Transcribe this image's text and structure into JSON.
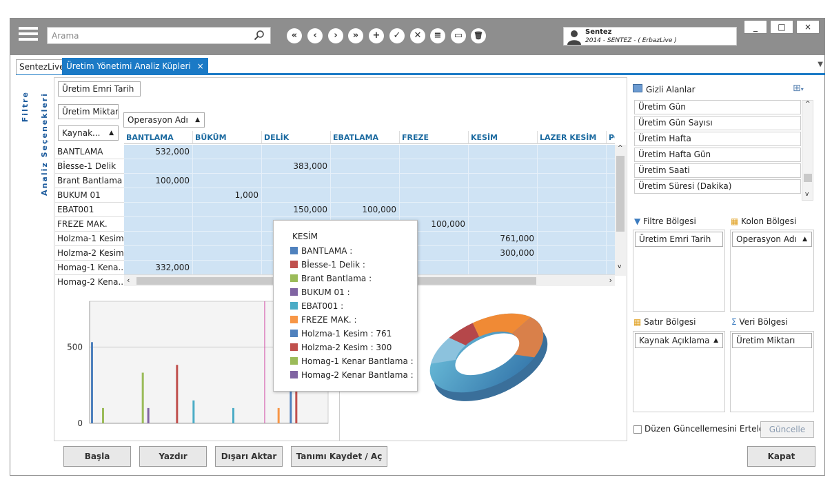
{
  "toolbar": {
    "search_placeholder": "Arama",
    "nav_labels": [
      "«",
      "‹",
      "›",
      "»",
      "+",
      "✓",
      "✕",
      "≡",
      "▭",
      "🗑"
    ]
  },
  "user": {
    "name": "Sentez",
    "subtitle": "2014 - SENTEZ - ( ErbazLive )"
  },
  "window_buttons": [
    "_",
    "□",
    "×"
  ],
  "tabs": [
    {
      "label": "SentezLive"
    },
    {
      "label": "Üretim Yönetimi Analiz Küpleri",
      "close": "×"
    }
  ],
  "side_labels": {
    "filter": "Filtre",
    "analysis": "Analiz Seçenekleri"
  },
  "pivot": {
    "filter_field": "Üretim Emri Tarih",
    "data_field": "Üretim Miktarı",
    "column_field": "Operasyon Adı",
    "row_field": "Kaynak...",
    "columns": [
      "BANTLAMA",
      "BÜKÜM",
      "DELİK",
      "EBATLAMA",
      "FREZE",
      "KESİM",
      "LAZER KESİM",
      "POS"
    ],
    "rows": [
      "BANTLAMA",
      "Bİesse-1 Delik",
      "Brant Bantlama",
      "BUKUM 01",
      "EBAT001",
      "FREZE MAK.",
      "Holzma-1 Kesim",
      "Holzma-2 Kesim",
      "Homag-1 Kena...",
      "Homag-2 Kena..."
    ],
    "values": [
      [
        "532,000",
        "",
        "",
        "",
        "",
        "",
        "",
        ""
      ],
      [
        "",
        "",
        "383,000",
        "",
        "",
        "",
        "",
        ""
      ],
      [
        "100,000",
        "",
        "",
        "",
        "",
        "",
        "",
        ""
      ],
      [
        "",
        "1,000",
        "",
        "",
        "",
        "",
        "",
        ""
      ],
      [
        "",
        "",
        "150,000",
        "100,000",
        "",
        "",
        "",
        ""
      ],
      [
        "",
        "",
        "",
        "",
        "100,000",
        "",
        "",
        ""
      ],
      [
        "",
        "",
        "",
        "",
        "",
        "761,000",
        "",
        ""
      ],
      [
        "",
        "",
        "",
        "",
        "",
        "300,000",
        "",
        ""
      ],
      [
        "332,000",
        "",
        "",
        "",
        "",
        "",
        "",
        ""
      ]
    ]
  },
  "tooltip": {
    "title": "KESİM",
    "items": [
      {
        "label": "BANTLAMA :",
        "color": "#4f81bd"
      },
      {
        "label": "Bİesse-1 Delik  :",
        "color": "#c0504d"
      },
      {
        "label": "Brant Bantlama   :",
        "color": "#9bbb59"
      },
      {
        "label": "BUKUM 01 :",
        "color": "#8064a2"
      },
      {
        "label": "EBAT001 :",
        "color": "#4bacc6"
      },
      {
        "label": "FREZE MAK. :",
        "color": "#f79646"
      },
      {
        "label": "Holzma-1 Kesim  : 761",
        "color": "#4f81bd"
      },
      {
        "label": "Holzma-2 Kesim  : 300",
        "color": "#c0504d"
      },
      {
        "label": "Homag-1 Kenar Bantlama :",
        "color": "#9bbb59"
      },
      {
        "label": "Homag-2 Kenar Bantlama :",
        "color": "#8064a2"
      }
    ]
  },
  "chart_data": {
    "type": "bar",
    "ytick_labels": [
      "500",
      "0"
    ],
    "ylim": [
      0,
      800
    ],
    "series_colors": [
      "#4f81bd",
      "#c0504d",
      "#9bbb59",
      "#8064a2",
      "#4bacc6",
      "#f79646"
    ],
    "bars": [
      {
        "group": 0,
        "series": 0,
        "value": 532
      },
      {
        "group": 0,
        "series": 2,
        "value": 100
      },
      {
        "group": 1,
        "series": 2,
        "value": 332
      },
      {
        "group": 1,
        "series": 3,
        "value": 100
      },
      {
        "group": 2,
        "series": 1,
        "value": 383
      },
      {
        "group": 2,
        "series": 4,
        "value": 150
      },
      {
        "group": 3,
        "series": 4,
        "value": 100
      },
      {
        "group": 4,
        "series": 5,
        "value": 100
      },
      {
        "group": 5,
        "series": 0,
        "value": 761
      },
      {
        "group": 5,
        "series": 1,
        "value": 300
      }
    ]
  },
  "right_panel": {
    "hidden_fields_title": "Gizli Alanlar",
    "hidden_fields": [
      "Üretim Gün",
      "Üretim Gün Sayısı",
      "Üretim Hafta",
      "Üretim Hafta Gün",
      "Üretim Saati",
      "Üretim Süresi (Dakika)"
    ],
    "filter_area": {
      "title": "Filtre Bölgesi",
      "items": [
        "Üretim Emri Tarih"
      ]
    },
    "column_area": {
      "title": "Kolon Bölgesi",
      "items": [
        "Operasyon Adı"
      ]
    },
    "row_area": {
      "title": "Satır Bölgesi",
      "items": [
        "Kaynak Açıklama"
      ]
    },
    "data_area": {
      "title": "Veri Bölgesi",
      "items": [
        "Üretim Miktarı"
      ]
    },
    "defer_label": "Düzen Güncellemesini Ertele",
    "update_label": "Güncelle"
  },
  "bottom_buttons": {
    "start": "Başla",
    "print": "Yazdır",
    "export": "Dışarı Aktar",
    "save_def": "Tanımı Kaydet / Aç",
    "close": "Kapat"
  }
}
